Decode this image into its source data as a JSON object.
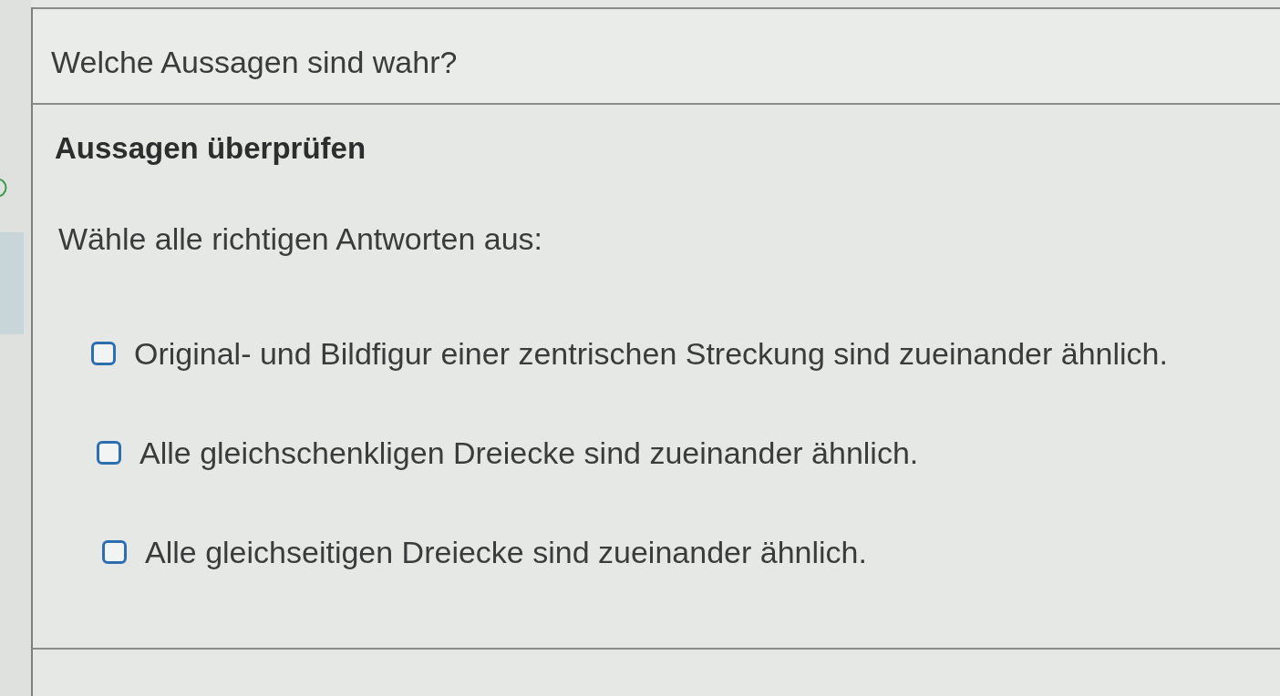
{
  "question": {
    "title": "Welche Aussagen sind wahr?"
  },
  "task": {
    "heading": "Aussagen überprüfen",
    "instruction": "Wähle alle richtigen Antworten aus:"
  },
  "options": [
    {
      "label": "Original- und Bildfigur einer zentrischen Streckung sind zueinander ähnlich.",
      "checked": false
    },
    {
      "label": "Alle gleichschenkligen Dreiecke sind zueinander ähnlich.",
      "checked": false
    },
    {
      "label": "Alle gleichseitigen Dreiecke sind zueinander ähnlich.",
      "checked": false
    }
  ]
}
